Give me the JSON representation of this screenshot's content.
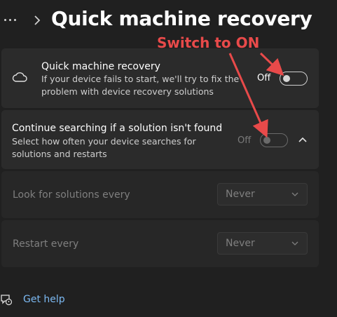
{
  "header": {
    "title": "Quick machine recovery"
  },
  "quick_recovery": {
    "title": "Quick machine recovery",
    "description_line1": "If your device fails to start, we'll try to fix the",
    "description_line2": "problem with device recovery solutions",
    "toggle_state": "Off",
    "icon": "cloud-icon"
  },
  "continue_searching": {
    "title": "Continue searching if a solution isn't found",
    "description_line1": "Select how often your device searches for",
    "description_line2": "solutions and restarts",
    "toggle_state": "Off"
  },
  "look_for_solutions": {
    "label": "Look for solutions every",
    "selected": "Never"
  },
  "restart_every": {
    "label": "Restart every",
    "selected": "Never"
  },
  "help": {
    "link": "Get help",
    "icon": "help-chat-icon"
  },
  "annotation": {
    "text": "Switch to ON",
    "color": "#e84a4a"
  },
  "colors": {
    "background": "#202020",
    "card": "#2b2b2b",
    "link": "#7cb9f2"
  }
}
